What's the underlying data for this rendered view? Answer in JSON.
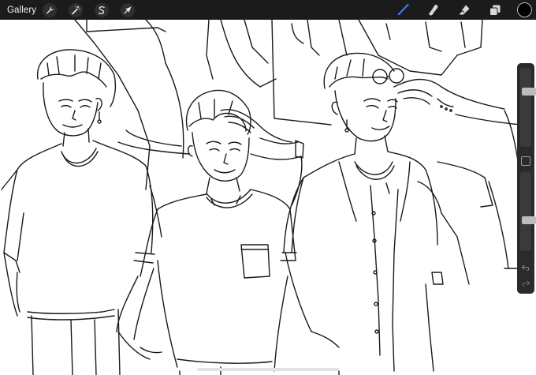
{
  "toolbar": {
    "gallery_label": "Gallery",
    "left_tools": [
      {
        "name": "actions",
        "icon": "wrench-icon"
      },
      {
        "name": "adjustments",
        "icon": "magic-wand-icon"
      },
      {
        "name": "selection",
        "icon": "selection-s-icon"
      },
      {
        "name": "transform",
        "icon": "arrow-cursor-icon"
      }
    ],
    "right_tools": [
      {
        "name": "brush",
        "icon": "brush-icon",
        "active": true
      },
      {
        "name": "smudge",
        "icon": "smudge-finger-icon",
        "active": false
      },
      {
        "name": "eraser",
        "icon": "eraser-icon",
        "active": false
      },
      {
        "name": "layers",
        "icon": "layers-icon",
        "active": false
      }
    ],
    "current_color": "#000000"
  },
  "sidebar": {
    "brush_size_level": 0.28,
    "opacity_level": 0.62
  },
  "colors": {
    "toolbar_bg": "#1b1b1b",
    "active_tool": "#3d77ff",
    "canvas_bg": "#ffffff",
    "line_art": "#1a1a1a"
  }
}
